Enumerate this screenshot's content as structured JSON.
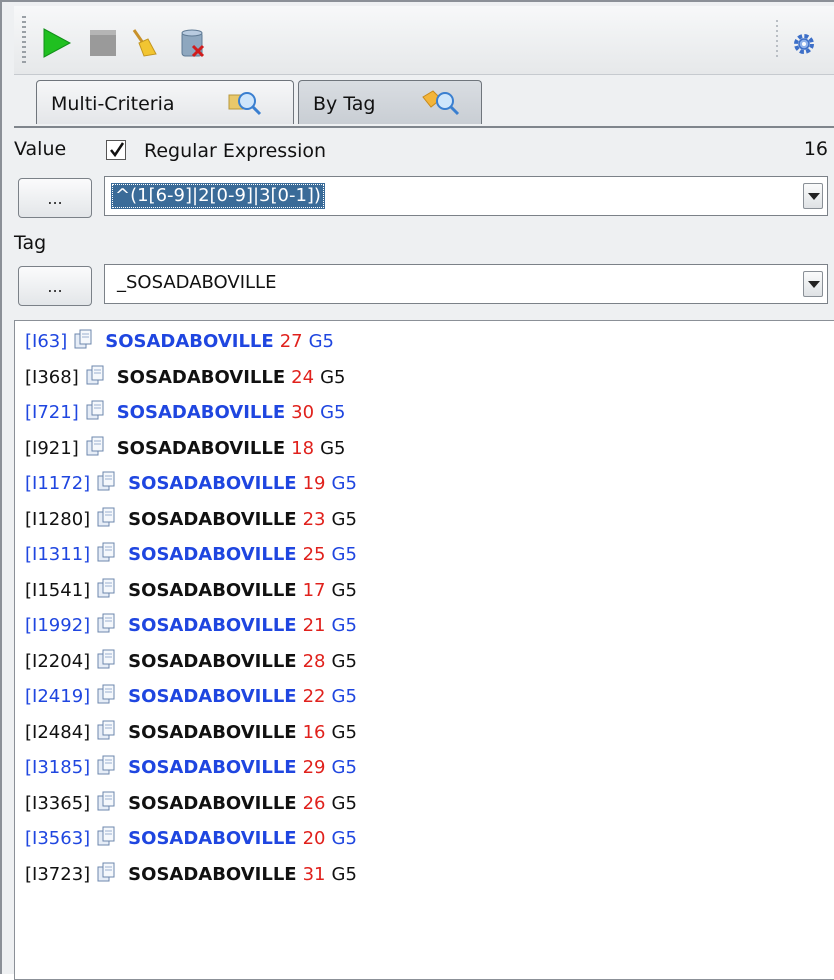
{
  "toolbar": {
    "buttons": [
      "play-icon",
      "stop-icon",
      "broom-icon",
      "database-clear-icon"
    ],
    "settings_icon": "gear-icon"
  },
  "tabs": [
    {
      "label": "Multi-Criteria",
      "icon": "search-icon",
      "active": false
    },
    {
      "label": "By Tag",
      "icon": "tag-search-icon",
      "active": true
    }
  ],
  "value": {
    "label": "Value",
    "regex_checked": true,
    "regex_label": "Regular Expression",
    "count": "16",
    "browse_label": "...",
    "current": "^(1[6-9]|2[0-9]|3[0-1])"
  },
  "tag": {
    "label": "Tag",
    "browse_label": "...",
    "current": "_SOSADABOVILLE"
  },
  "colors": {
    "blue_row": "#1f46e0",
    "age": "#e0211c",
    "selection": "#3a6b98"
  },
  "results": [
    {
      "id": "[I63]",
      "name": "SOSADABOVILLE",
      "age": "27",
      "gen": "G5",
      "style": "blue"
    },
    {
      "id": "[I368]",
      "name": "SOSADABOVILLE",
      "age": "24",
      "gen": "G5",
      "style": "black"
    },
    {
      "id": "[I721]",
      "name": "SOSADABOVILLE",
      "age": "30",
      "gen": "G5",
      "style": "blue"
    },
    {
      "id": "[I921]",
      "name": "SOSADABOVILLE",
      "age": "18",
      "gen": "G5",
      "style": "black"
    },
    {
      "id": "[I1172]",
      "name": "SOSADABOVILLE",
      "age": "19",
      "gen": "G5",
      "style": "blue"
    },
    {
      "id": "[I1280]",
      "name": "SOSADABOVILLE",
      "age": "23",
      "gen": "G5",
      "style": "black"
    },
    {
      "id": "[I1311]",
      "name": "SOSADABOVILLE",
      "age": "25",
      "gen": "G5",
      "style": "blue"
    },
    {
      "id": "[I1541]",
      "name": "SOSADABOVILLE",
      "age": "17",
      "gen": "G5",
      "style": "black"
    },
    {
      "id": "[I1992]",
      "name": "SOSADABOVILLE",
      "age": "21",
      "gen": "G5",
      "style": "blue"
    },
    {
      "id": "[I2204]",
      "name": "SOSADABOVILLE",
      "age": "28",
      "gen": "G5",
      "style": "black"
    },
    {
      "id": "[I2419]",
      "name": "SOSADABOVILLE",
      "age": "22",
      "gen": "G5",
      "style": "blue"
    },
    {
      "id": "[I2484]",
      "name": "SOSADABOVILLE",
      "age": "16",
      "gen": "G5",
      "style": "black"
    },
    {
      "id": "[I3185]",
      "name": "SOSADABOVILLE",
      "age": "29",
      "gen": "G5",
      "style": "blue"
    },
    {
      "id": "[I3365]",
      "name": "SOSADABOVILLE",
      "age": "26",
      "gen": "G5",
      "style": "black"
    },
    {
      "id": "[I3563]",
      "name": "SOSADABOVILLE",
      "age": "20",
      "gen": "G5",
      "style": "blue"
    },
    {
      "id": "[I3723]",
      "name": "SOSADABOVILLE",
      "age": "31",
      "gen": "G5",
      "style": "black"
    }
  ]
}
